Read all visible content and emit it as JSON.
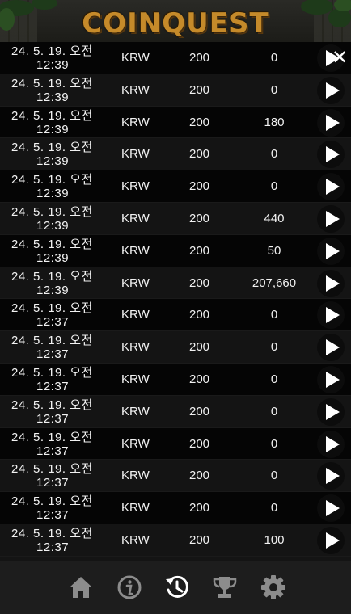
{
  "app": {
    "logo_text": "COINQUEST"
  },
  "close_label": "✕",
  "history": {
    "rows": [
      {
        "date_line1": "24. 5. 19. 오전",
        "date_line2": "12:39",
        "currency": "KRW",
        "bet": "200",
        "win": "0"
      },
      {
        "date_line1": "24. 5. 19. 오전",
        "date_line2": "12:39",
        "currency": "KRW",
        "bet": "200",
        "win": "0"
      },
      {
        "date_line1": "24. 5. 19. 오전",
        "date_line2": "12:39",
        "currency": "KRW",
        "bet": "200",
        "win": "180"
      },
      {
        "date_line1": "24. 5. 19. 오전",
        "date_line2": "12:39",
        "currency": "KRW",
        "bet": "200",
        "win": "0"
      },
      {
        "date_line1": "24. 5. 19. 오전",
        "date_line2": "12:39",
        "currency": "KRW",
        "bet": "200",
        "win": "0"
      },
      {
        "date_line1": "24. 5. 19. 오전",
        "date_line2": "12:39",
        "currency": "KRW",
        "bet": "200",
        "win": "440"
      },
      {
        "date_line1": "24. 5. 19. 오전",
        "date_line2": "12:39",
        "currency": "KRW",
        "bet": "200",
        "win": "50"
      },
      {
        "date_line1": "24. 5. 19. 오전",
        "date_line2": "12:39",
        "currency": "KRW",
        "bet": "200",
        "win": "207,660"
      },
      {
        "date_line1": "24. 5. 19. 오전",
        "date_line2": "12:37",
        "currency": "KRW",
        "bet": "200",
        "win": "0"
      },
      {
        "date_line1": "24. 5. 19. 오전",
        "date_line2": "12:37",
        "currency": "KRW",
        "bet": "200",
        "win": "0"
      },
      {
        "date_line1": "24. 5. 19. 오전",
        "date_line2": "12:37",
        "currency": "KRW",
        "bet": "200",
        "win": "0"
      },
      {
        "date_line1": "24. 5. 19. 오전",
        "date_line2": "12:37",
        "currency": "KRW",
        "bet": "200",
        "win": "0"
      },
      {
        "date_line1": "24. 5. 19. 오전",
        "date_line2": "12:37",
        "currency": "KRW",
        "bet": "200",
        "win": "0"
      },
      {
        "date_line1": "24. 5. 19. 오전",
        "date_line2": "12:37",
        "currency": "KRW",
        "bet": "200",
        "win": "0"
      },
      {
        "date_line1": "24. 5. 19. 오전",
        "date_line2": "12:37",
        "currency": "KRW",
        "bet": "200",
        "win": "0"
      },
      {
        "date_line1": "24. 5. 19. 오전",
        "date_line2": "12:37",
        "currency": "KRW",
        "bet": "200",
        "win": "100"
      }
    ]
  },
  "nav": {
    "items": [
      {
        "icon": "home-icon",
        "active": false
      },
      {
        "icon": "info-icon",
        "active": false
      },
      {
        "icon": "history-icon",
        "active": true
      },
      {
        "icon": "trophy-icon",
        "active": false
      },
      {
        "icon": "gear-icon",
        "active": false
      }
    ]
  },
  "colors": {
    "logo": "#c58a2a",
    "row_dark": "#050505",
    "row_light": "#141414",
    "nav_bg": "#1d1d1d",
    "nav_icon": "#8c8c8c",
    "nav_icon_active": "#ffffff"
  }
}
